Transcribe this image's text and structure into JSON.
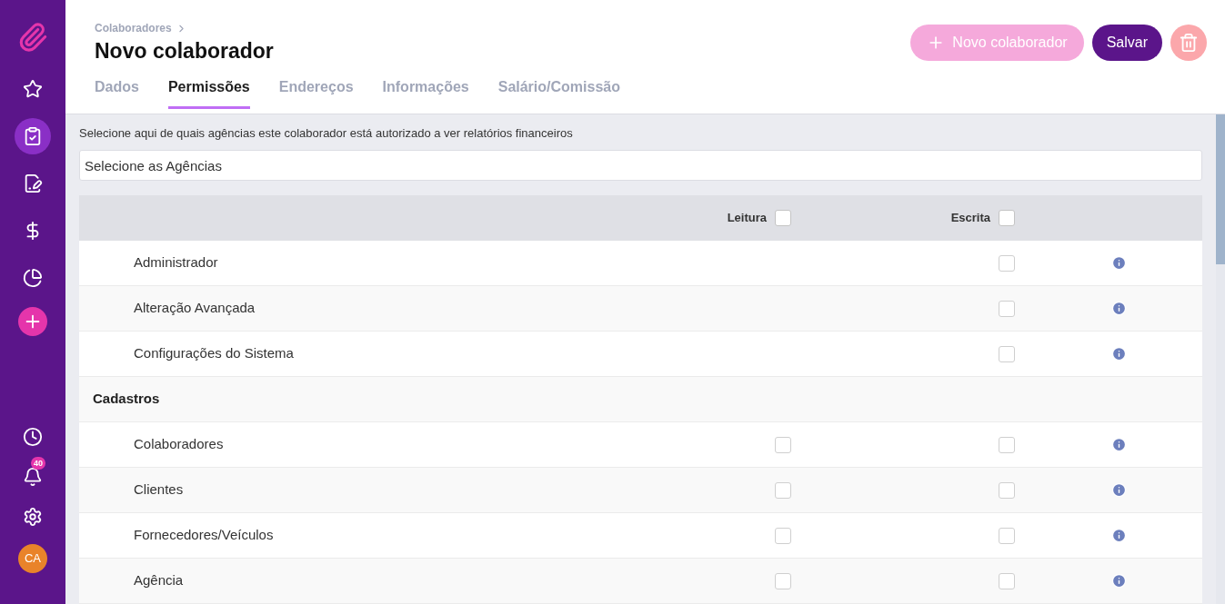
{
  "sidebar": {
    "items": [
      {
        "selected": false
      },
      {
        "selected": true
      },
      {
        "selected": false
      },
      {
        "selected": false
      },
      {
        "selected": false
      }
    ],
    "notification_badge": "40",
    "avatar": "CA"
  },
  "breadcrumb": "Colaboradores",
  "title": "Novo colaborador",
  "actions": {
    "new_button": "Novo colaborador",
    "new_disabled": true,
    "save_button": "Salvar",
    "delete_disabled": true
  },
  "tabs": [
    {
      "label": "Dados",
      "selected": false
    },
    {
      "label": "Permissões",
      "selected": true
    },
    {
      "label": "Endereços",
      "selected": false
    },
    {
      "label": "Informações",
      "selected": false
    },
    {
      "label": "Salário/Comissão",
      "selected": false
    }
  ],
  "agencies_hint": "Selecione aqui de quais agências este colaborador está autorizado a ver relatórios financeiros",
  "agencies_field": {
    "placeholder": "Selecione as Agências"
  },
  "table": {
    "read_header": "Leitura",
    "read_all_checked": false,
    "write_header": "Escrita",
    "write_all_checked": false,
    "rows": [
      {
        "kind": "permission",
        "label": "Administrador",
        "write_checked": false
      },
      {
        "kind": "permission",
        "label": "Alteração Avançada",
        "write_checked": false
      },
      {
        "kind": "permission",
        "label": "Configurações do Sistema",
        "write_checked": false
      },
      {
        "kind": "section",
        "label": "Cadastros"
      },
      {
        "kind": "permission",
        "label": "Colaboradores",
        "read_checked": false,
        "write_checked": false
      },
      {
        "kind": "permission",
        "label": "Clientes",
        "read_checked": false,
        "write_checked": false
      },
      {
        "kind": "permission",
        "label": "Fornecedores/Veículos",
        "read_checked": false,
        "write_checked": false
      },
      {
        "kind": "permission",
        "label": "Agência",
        "read_checked": false,
        "write_checked": false
      }
    ]
  }
}
